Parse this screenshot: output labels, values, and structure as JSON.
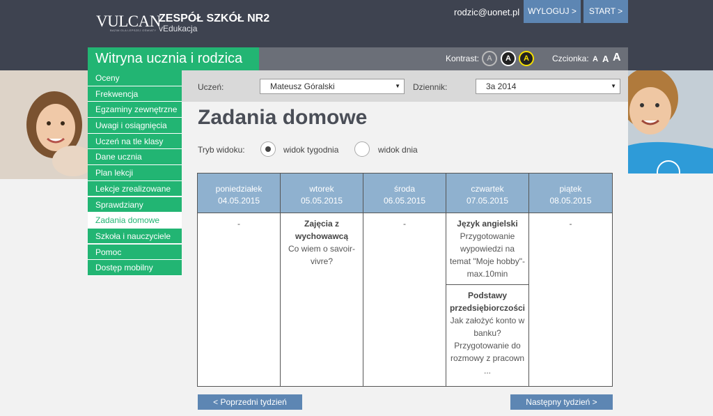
{
  "header": {
    "logo_text": "VULCAN",
    "logo_sub": "BAZIM OLA LEPSZEJ OŚWIATY",
    "school_name": "ZESPÓŁ SZKÓŁ NR2",
    "school_sub": "vEdukacja",
    "user_email": "rodzic@uonet.pl",
    "logout_label": "WYLOGUJ >",
    "start_label": "START >"
  },
  "subheader": {
    "site_title": "Witryna ucznia i rodzica",
    "contrast_label": "Kontrast:",
    "contrast_options": [
      "A",
      "A",
      "A"
    ],
    "font_label": "Czcionka:",
    "font_sizes": [
      "A",
      "A",
      "A"
    ]
  },
  "sidebar": {
    "items": [
      {
        "label": "Oceny"
      },
      {
        "label": "Frekwencja"
      },
      {
        "label": "Egzaminy zewnętrzne"
      },
      {
        "label": "Uwagi i osiągnięcia"
      },
      {
        "label": "Uczeń na tle klasy"
      },
      {
        "label": "Dane ucznia"
      },
      {
        "label": "Plan lekcji"
      },
      {
        "label": "Lekcje zrealizowane"
      },
      {
        "label": "Sprawdziany"
      },
      {
        "label": "Zadania domowe"
      },
      {
        "label": "Szkoła i nauczyciele"
      },
      {
        "label": "Pomoc"
      },
      {
        "label": "Dostęp mobilny"
      }
    ],
    "active_index": 9
  },
  "filters": {
    "student_label": "Uczeń:",
    "student_value": "Mateusz Góralski",
    "journal_label": "Dziennik:",
    "journal_value": "3a 2014"
  },
  "main": {
    "title": "Zadania domowe",
    "mode_label": "Tryb widoku:",
    "mode_week": "widok tygodnia",
    "mode_day": "widok dnia",
    "selected_mode": "widok tygodnia"
  },
  "calendar": {
    "days": [
      {
        "name": "poniedziałek",
        "date": "04.05.2015",
        "empty": "-",
        "entries": []
      },
      {
        "name": "wtorek",
        "date": "05.05.2015",
        "empty": "",
        "entries": [
          {
            "subject": "Zajęcia z wychowawcą",
            "text": "Co wiem o savoir-vivre?"
          }
        ]
      },
      {
        "name": "środa",
        "date": "06.05.2015",
        "empty": "-",
        "entries": []
      },
      {
        "name": "czwartek",
        "date": "07.05.2015",
        "empty": "",
        "entries": [
          {
            "subject": "Język angielski",
            "text": "Przygotowanie wypowiedzi na temat \"Moje hobby\"- max.10min"
          },
          {
            "subject": "Podstawy przedsiębiorczości",
            "text": "Jak założyć konto w banku? Przygotowanie do rozmowy z pracown ..."
          }
        ]
      },
      {
        "name": "piątek",
        "date": "08.05.2015",
        "empty": "-",
        "entries": []
      }
    ]
  },
  "pagination": {
    "prev_label": "< Poprzedni tydzień",
    "next_label": "Następny tydzień >"
  },
  "colors": {
    "accent_green": "#22b573",
    "header_dark": "#3e4350",
    "button_blue": "#5d86b3",
    "calendar_head": "#8fb1cf"
  },
  "icons": {
    "select_arrow": "caret-down-icon",
    "radio_checked": "radio-checked-icon",
    "radio_unchecked": "radio-unchecked-icon"
  }
}
